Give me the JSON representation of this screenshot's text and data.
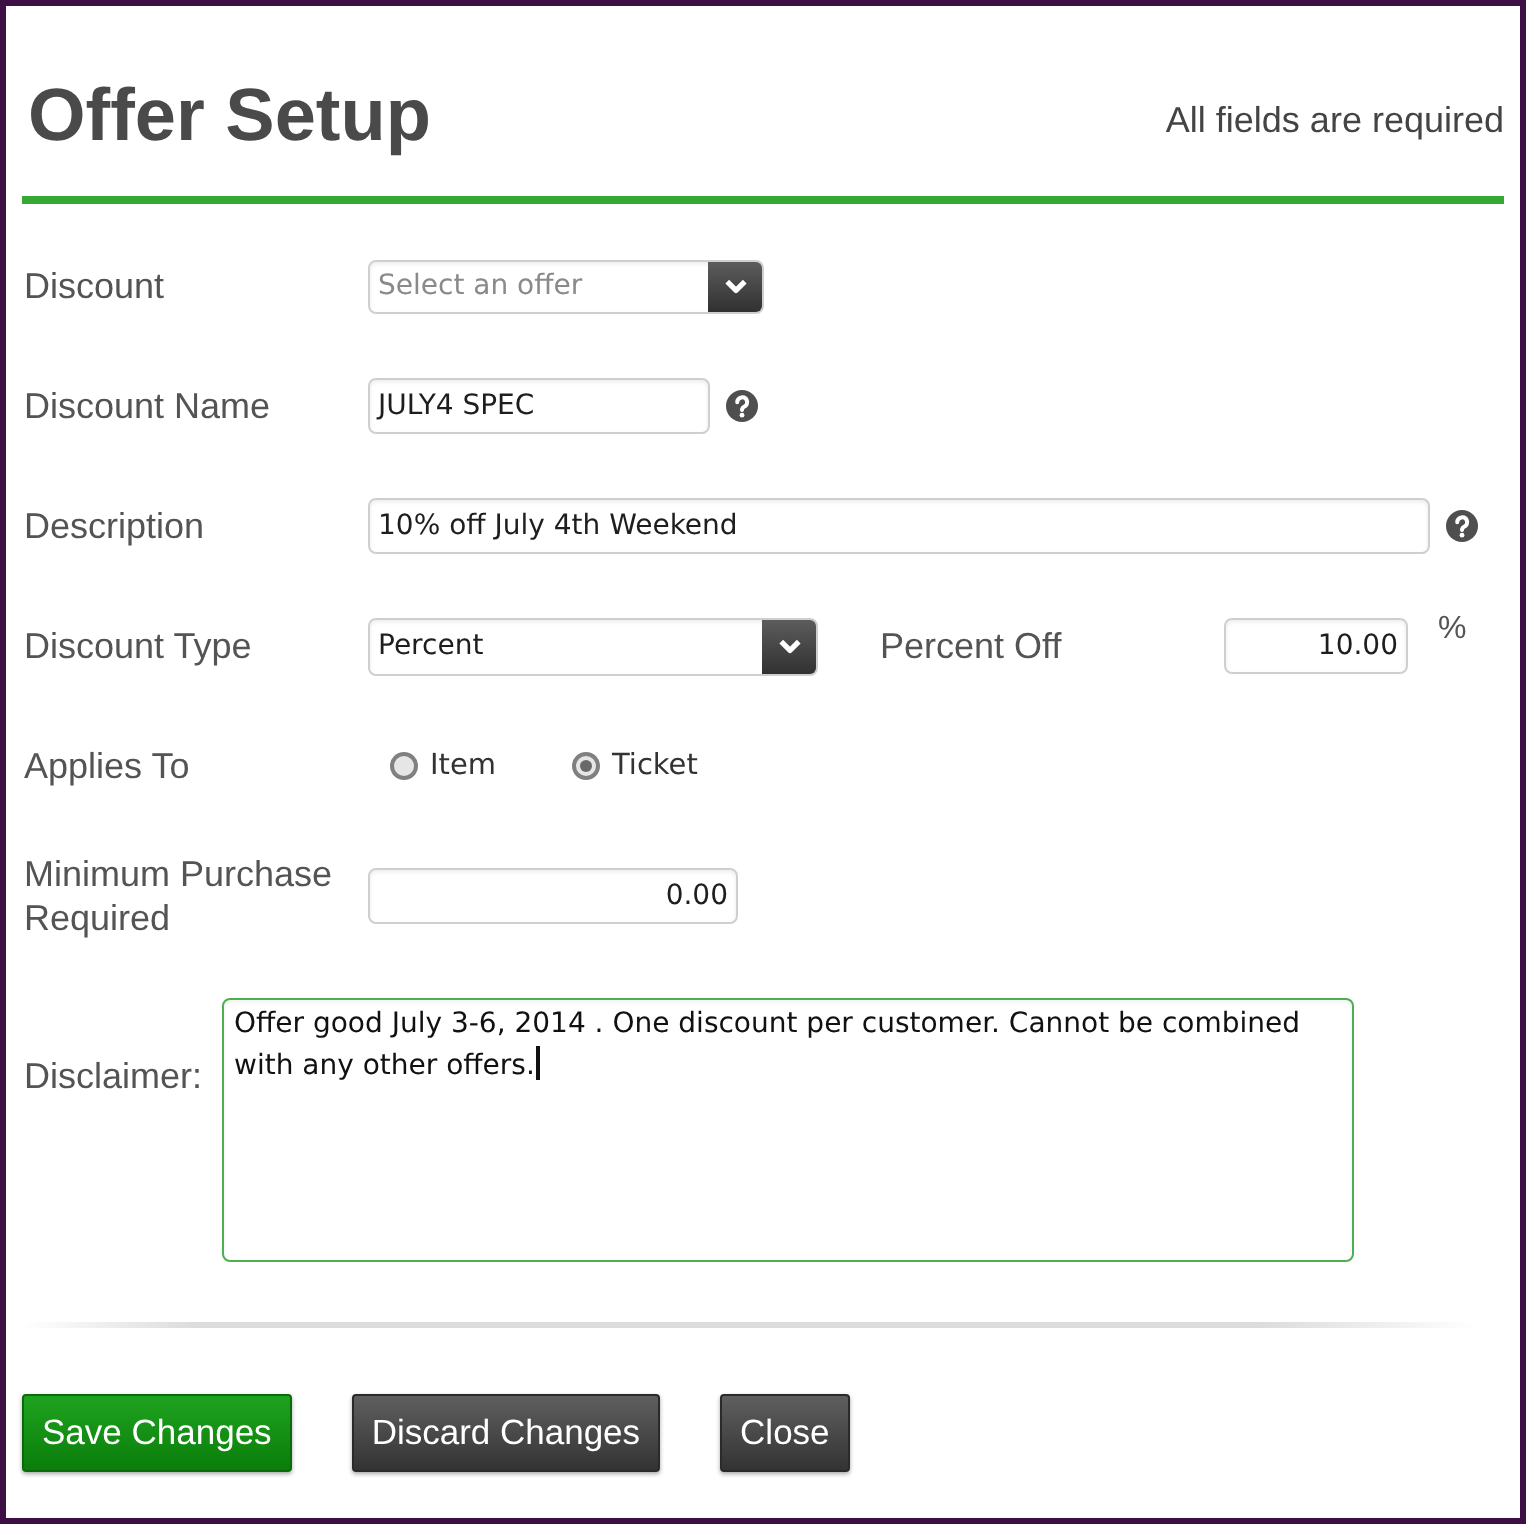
{
  "window": {
    "title": "Offer Setup",
    "note": "All fields are required"
  },
  "fields": [
    {
      "kind": "select",
      "label": "Discount",
      "placeholder": "Select an offer"
    },
    {
      "kind": "text",
      "label": "Discount Name",
      "value": "JULY4 SPEC",
      "help": true
    },
    {
      "kind": "text",
      "label": "Description",
      "value": "10% off July 4th Weekend",
      "help": true
    },
    {
      "kind": "select_number",
      "label": "Discount Type",
      "value": "Percent",
      "extra": {
        "label": "Percent Off",
        "value": "10.00",
        "unit": "%"
      }
    },
    {
      "kind": "radio",
      "label": "Applies To",
      "options": [
        {
          "label": "Item",
          "selected": false
        },
        {
          "label": "Ticket",
          "selected": true
        }
      ]
    },
    {
      "kind": "number",
      "label": "Minimum Purchase Required",
      "value": "0.00"
    },
    {
      "kind": "textarea",
      "label": "Disclaimer:",
      "value": "Offer good July 3-6, 2014 . One discount per customer. Cannot be combined with any other offers.",
      "focused": true
    }
  ],
  "buttons": [
    {
      "label": "Save Changes",
      "kind": "primary"
    },
    {
      "label": "Discard Changes",
      "kind": "secondary"
    },
    {
      "label": "Close",
      "kind": "secondary"
    }
  ]
}
